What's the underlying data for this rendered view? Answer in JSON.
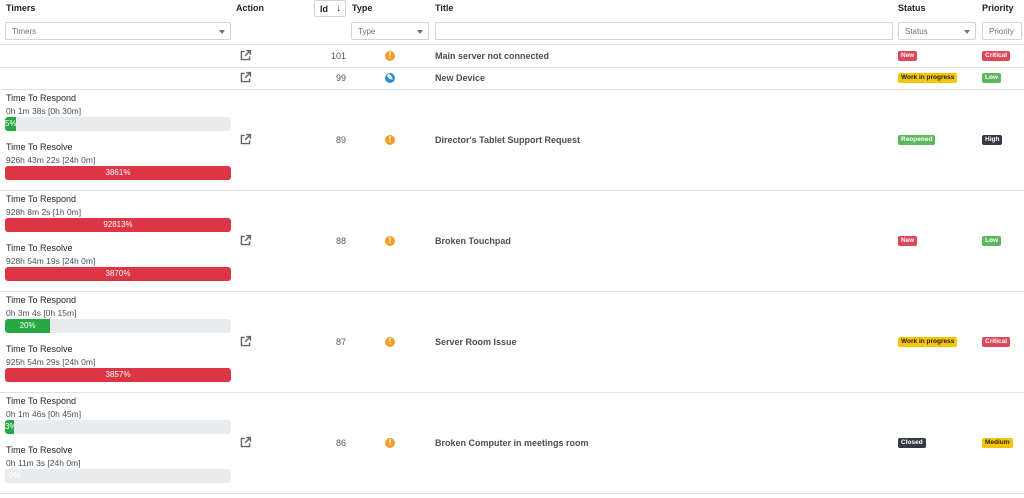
{
  "header": {
    "timers": "Timers",
    "action": "Action",
    "id": "Id",
    "id_sort_icon": "arrow-down-icon",
    "type": "Type",
    "title": "Title",
    "status": "Status",
    "priority": "Priority"
  },
  "filters": {
    "timers": "Timers",
    "type": "Type",
    "title": "",
    "status": "Status",
    "priority": "Priority"
  },
  "colors": {
    "critical": "#e0475a",
    "work_in_progress": "#f5c500",
    "low": "#5cb85c",
    "high": "#343a40",
    "progress_green": "#28a745",
    "progress_red": "#dc3545",
    "type_incident": "#f0a028",
    "type_request": "#2f8cd8"
  },
  "rows": [
    {
      "id": "101",
      "type_icon": "exclamation-icon",
      "title": "Main server not connected",
      "status": "New",
      "priority": "Critical"
    },
    {
      "id": "99",
      "type_icon": "device-request-icon",
      "title": "New Device",
      "status": "Work in progress",
      "priority": "Low"
    },
    {
      "id": "89",
      "type_icon": "exclamation-icon",
      "title": "Director's Tablet Support Request",
      "status": "Reopened",
      "priority": "High",
      "timers": [
        {
          "label": "Time To Respond",
          "value": "0h 1m 38s [0h 30m]",
          "percent": 5,
          "text": "5%"
        },
        {
          "label": "Time To Resolve",
          "value": "926h 43m 22s [24h 0m]",
          "percent": 100,
          "text": "3861%"
        }
      ]
    },
    {
      "id": "88",
      "type_icon": "exclamation-icon",
      "title": "Broken Touchpad",
      "status": "New",
      "priority": "Low",
      "timers": [
        {
          "label": "Time To Respond",
          "value": "928h 8m 2s [1h 0m]",
          "percent": 100,
          "text": "92813%"
        },
        {
          "label": "Time To Resolve",
          "value": "928h 54m 19s [24h 0m]",
          "percent": 100,
          "text": "3870%"
        }
      ]
    },
    {
      "id": "87",
      "type_icon": "exclamation-icon",
      "title": "Server Room Issue",
      "status": "Work in progress",
      "priority": "Critical",
      "timers": [
        {
          "label": "Time To Respond",
          "value": "0h 3m 4s [0h 15m]",
          "percent": 20,
          "text": "20%"
        },
        {
          "label": "Time To Resolve",
          "value": "925h 54m 29s [24h 0m]",
          "percent": 100,
          "text": "3857%"
        }
      ]
    },
    {
      "id": "86",
      "type_icon": "exclamation-icon",
      "title": "Broken Computer in meetings room",
      "status": "Closed",
      "priority": "Medium",
      "timers": [
        {
          "label": "Time To Respond",
          "value": "0h 1m 46s [0h 45m]",
          "percent": 3,
          "text": "3%"
        },
        {
          "label": "Time To Resolve",
          "value": "0h 11m 3s [24h 0m]",
          "percent": 0,
          "text": "0%"
        }
      ]
    }
  ]
}
